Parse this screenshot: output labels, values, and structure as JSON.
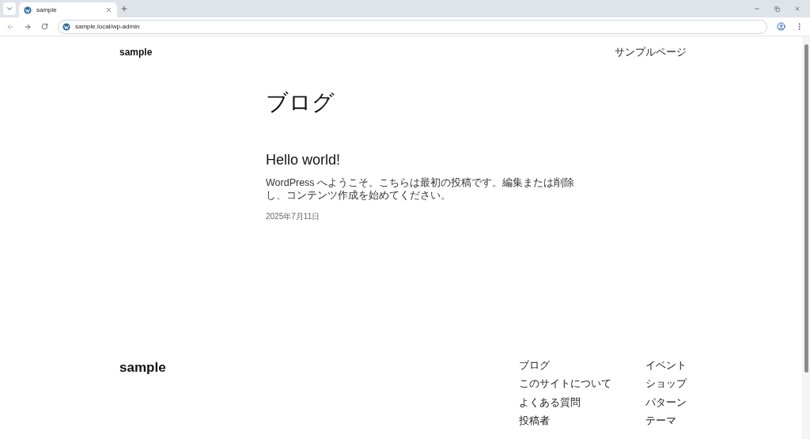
{
  "browser": {
    "tabs": [
      {
        "title": "sample",
        "selected": true
      }
    ],
    "address": "sample.local/wp-admin"
  },
  "header": {
    "site_title": "sample",
    "nav": [
      "サンプルページ"
    ]
  },
  "page_title": "ブログ",
  "posts": [
    {
      "title": "Hello world!",
      "excerpt": "WordPress へようこそ。こちらは最初の投稿です。編集または削除し、コンテンツ作成を始めてください。",
      "date": "2025年7月11日"
    }
  ],
  "footer": {
    "site_title": "sample",
    "columns": [
      [
        "ブログ",
        "このサイトについて",
        "よくある質問",
        "投稿者"
      ],
      [
        "イベント",
        "ショップ",
        "パターン",
        "テーマ"
      ]
    ]
  }
}
